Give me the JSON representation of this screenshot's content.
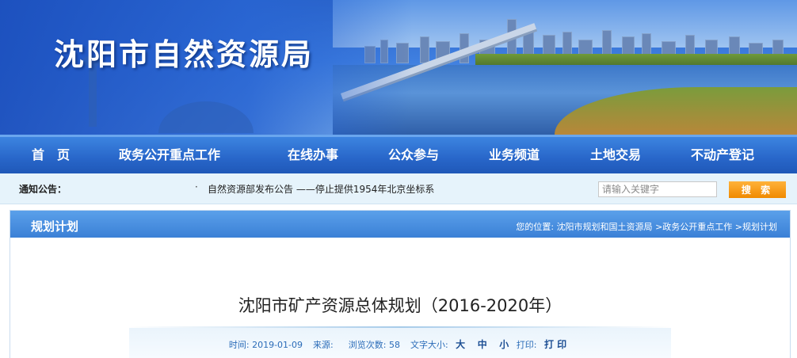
{
  "site": {
    "title": "沈阳市自然资源局"
  },
  "nav": {
    "items": [
      {
        "label": "首　页"
      },
      {
        "label": "政务公开重点工作"
      },
      {
        "label": "在线办事"
      },
      {
        "label": "公众参与"
      },
      {
        "label": "业务频道"
      },
      {
        "label": "土地交易"
      },
      {
        "label": "不动产登记"
      }
    ]
  },
  "notice": {
    "label": "通知公告：",
    "bullet": "·",
    "text": "自然资源部发布公告 ——停止提供1954年北京坐标系"
  },
  "search": {
    "placeholder": "请输入关键字",
    "button_label": "搜 索"
  },
  "section": {
    "title": "规划计划",
    "breadcrumb": {
      "prefix": "您的位置:",
      "items": [
        "沈阳市规划和国土资源局",
        ">政务公开重点工作",
        ">规划计划"
      ]
    }
  },
  "article": {
    "title": "沈阳市矿产资源总体规划（2016-2020年）",
    "meta": {
      "time_label": "时间:",
      "time_value": "2019-01-09",
      "source_label": "来源:",
      "source_value": "",
      "views_label": "浏览次数:",
      "views_value": "58",
      "fontsize_label": "文字大小:",
      "size_large": "大",
      "size_medium": "中",
      "size_small": "小",
      "print_label": "打印:",
      "print_action": "打 印"
    }
  },
  "colors": {
    "nav_bg": "#2866c9",
    "notice_bg": "#e6f3fb",
    "search_button": "#f08a00",
    "header_bg": "#3b80d6",
    "meta_text": "#2b6cb8"
  },
  "icons": {
    "banner_image": "city-skyline-bridge-lake"
  }
}
